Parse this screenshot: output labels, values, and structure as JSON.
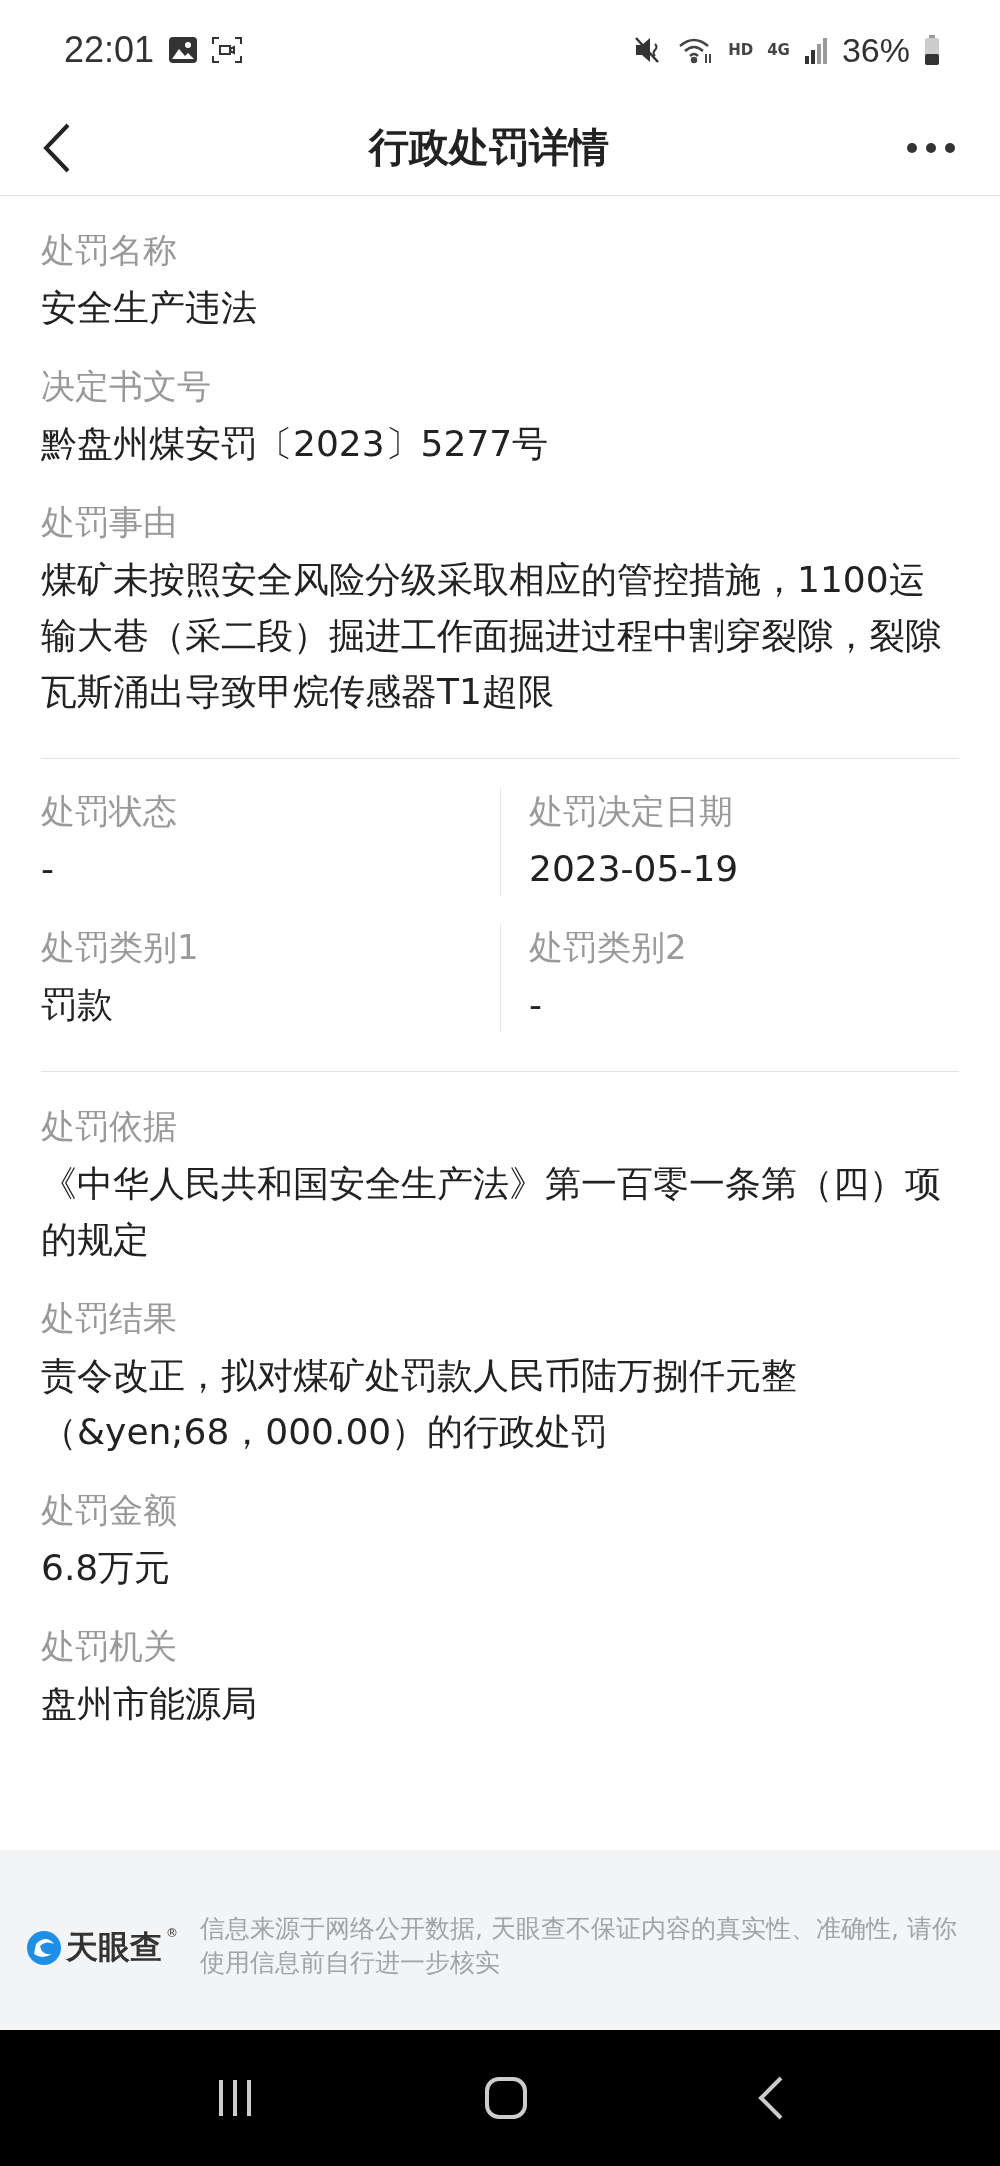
{
  "status_bar": {
    "time": "22:01",
    "hd_label": "HD",
    "network_type": "4G",
    "battery": "36%"
  },
  "header": {
    "title": "行政处罚详情"
  },
  "sections": [
    {
      "kind": "list",
      "fields": [
        {
          "label": "处罚名称",
          "value": "安全生产违法"
        },
        {
          "label": "决定书文号",
          "value": "黔盘州煤安罚〔2023〕5277号"
        },
        {
          "label": "处罚事由",
          "value": "煤矿未按照安全风险分级采取相应的管控措施，1100运输大巷（采二段）掘进工作面掘进过程中割穿裂隙，裂隙瓦斯涌出导致甲烷传感器T1超限"
        }
      ]
    },
    {
      "kind": "grid",
      "fields": [
        {
          "label": "处罚状态",
          "value": "-"
        },
        {
          "label": "处罚决定日期",
          "value": "2023-05-19"
        },
        {
          "label": "处罚类别1",
          "value": "罚款"
        },
        {
          "label": "处罚类别2",
          "value": "-"
        }
      ]
    },
    {
      "kind": "list",
      "fields": [
        {
          "label": "处罚依据",
          "value": "《中华人民共和国安全生产法》第一百零一条第（四）项的规定"
        },
        {
          "label": "处罚结果",
          "value": "责令改正，拟对煤矿处罚款人民币陆万捌仟元整（&yen;68，000.00）的行政处罚"
        },
        {
          "label": "处罚金额",
          "value": "6.8万元"
        },
        {
          "label": "处罚机关",
          "value": "盘州市能源局"
        }
      ]
    }
  ],
  "footer": {
    "logo_text": "天眼查",
    "logo_mark": "®",
    "notice": "信息来源于网络公开数据, 天眼查不保证内容的真实性、准确性, 请你使用信息前自行进一步核实"
  }
}
